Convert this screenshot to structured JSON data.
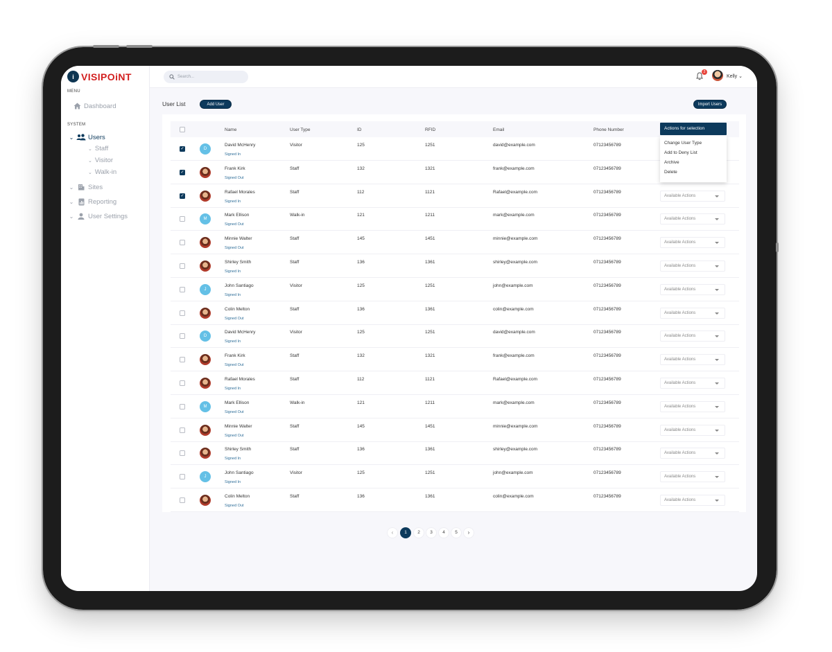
{
  "brand": {
    "name": "VISIPOiNT"
  },
  "sidebar": {
    "menu_label": "MENU",
    "system_label": "SYSTEM",
    "dashboard": "Dashboard",
    "users": "Users",
    "user_children": [
      "Staff",
      "Visitor",
      "Walk-in"
    ],
    "sites": "Sites",
    "reporting": "Reporting",
    "user_settings": "User Settings"
  },
  "topbar": {
    "search_placeholder": "Search...",
    "notification_count": "2",
    "user_name": "Kelly"
  },
  "page": {
    "title": "User List",
    "add_user": "Add User",
    "import_users": "Import Users"
  },
  "table": {
    "columns": [
      "Name",
      "User Type",
      "ID",
      "RFID",
      "Email",
      "Phone Number"
    ],
    "rows": [
      {
        "name": "David McHenry",
        "status": "Signed In",
        "type": "Visitor",
        "id": "125",
        "rfid": "1251",
        "email": "david@example.com",
        "phone": "07123456789",
        "avatar": "D",
        "checked": true,
        "actions": ""
      },
      {
        "name": "Frank Kirk",
        "status": "Signed Out",
        "type": "Staff",
        "id": "132",
        "rfid": "1321",
        "email": "frank@example.com",
        "phone": "07123456789",
        "avatar": "",
        "checked": true,
        "actions": ""
      },
      {
        "name": "Rafael Morales",
        "status": "Signed In",
        "type": "Staff",
        "id": "112",
        "rfid": "1121",
        "email": "Rafael@example.com",
        "phone": "07123456789",
        "avatar": "",
        "checked": true,
        "actions": "Available Actions"
      },
      {
        "name": "Mark Ellison",
        "status": "Signed Out",
        "type": "Walk-in",
        "id": "121",
        "rfid": "1211",
        "email": "mark@example.com",
        "phone": "07123456789",
        "avatar": "M",
        "checked": false,
        "actions": "Available Actions"
      },
      {
        "name": "Minnie Walter",
        "status": "Signed Out",
        "type": "Staff",
        "id": "145",
        "rfid": "1451",
        "email": "minnie@example.com",
        "phone": "07123456789",
        "avatar": "",
        "checked": false,
        "actions": "Available Actions"
      },
      {
        "name": "Shirley Smith",
        "status": "Signed In",
        "type": "Staff",
        "id": "136",
        "rfid": "1361",
        "email": "shirley@example.com",
        "phone": "07123456789",
        "avatar": "",
        "checked": false,
        "actions": "Available Actions"
      },
      {
        "name": "John Santiago",
        "status": "Signed In",
        "type": "Visitor",
        "id": "125",
        "rfid": "1251",
        "email": "john@example.com",
        "phone": "07123456789",
        "avatar": "J",
        "checked": false,
        "actions": "Available Actions"
      },
      {
        "name": "Colin Melton",
        "status": "Signed Out",
        "type": "Staff",
        "id": "136",
        "rfid": "1361",
        "email": "colin@example.com",
        "phone": "07123456789",
        "avatar": "",
        "checked": false,
        "actions": "Available Actions"
      },
      {
        "name": "David McHenry",
        "status": "Signed In",
        "type": "Visitor",
        "id": "125",
        "rfid": "1251",
        "email": "david@example.com",
        "phone": "07123456789",
        "avatar": "D",
        "checked": false,
        "actions": "Available Actions"
      },
      {
        "name": "Frank Kirk",
        "status": "Signed Out",
        "type": "Staff",
        "id": "132",
        "rfid": "1321",
        "email": "frank@example.com",
        "phone": "07123456789",
        "avatar": "",
        "checked": false,
        "actions": "Available Actions"
      },
      {
        "name": "Rafael Morales",
        "status": "Signed In",
        "type": "Staff",
        "id": "112",
        "rfid": "1121",
        "email": "Rafael@example.com",
        "phone": "07123456789",
        "avatar": "",
        "checked": false,
        "actions": "Available Actions"
      },
      {
        "name": "Mark Ellison",
        "status": "Signed Out",
        "type": "Walk-in",
        "id": "121",
        "rfid": "1211",
        "email": "mark@example.com",
        "phone": "07123456789",
        "avatar": "M",
        "checked": false,
        "actions": "Available Actions"
      },
      {
        "name": "Minnie Walter",
        "status": "Signed Out",
        "type": "Staff",
        "id": "145",
        "rfid": "1451",
        "email": "minnie@example.com",
        "phone": "07123456789",
        "avatar": "",
        "checked": false,
        "actions": "Available Actions"
      },
      {
        "name": "Shirley Smith",
        "status": "Signed In",
        "type": "Staff",
        "id": "136",
        "rfid": "1361",
        "email": "shirley@example.com",
        "phone": "07123456789",
        "avatar": "",
        "checked": false,
        "actions": "Available Actions"
      },
      {
        "name": "John Santiago",
        "status": "Signed In",
        "type": "Visitor",
        "id": "125",
        "rfid": "1251",
        "email": "john@example.com",
        "phone": "07123456789",
        "avatar": "J",
        "checked": false,
        "actions": "Available Actions"
      },
      {
        "name": "Colin Melton",
        "status": "Signed Out",
        "type": "Staff",
        "id": "136",
        "rfid": "1361",
        "email": "colin@example.com",
        "phone": "07123456789",
        "avatar": "",
        "checked": false,
        "actions": "Available Actions"
      }
    ]
  },
  "bulk_actions": {
    "label": "Actions for selection",
    "items": [
      "Change User Type",
      "Add to Deny List",
      "Archive",
      "Delete"
    ]
  },
  "pagination": {
    "pages": [
      "1",
      "2",
      "3",
      "4",
      "5"
    ],
    "current": "1",
    "prev": "‹",
    "next": "›"
  },
  "colors": {
    "primary": "#0d3a5c",
    "logo_red": "#d21f1f",
    "status_blue": "#2f6e99",
    "avatar_blue": "#64c0e6"
  }
}
